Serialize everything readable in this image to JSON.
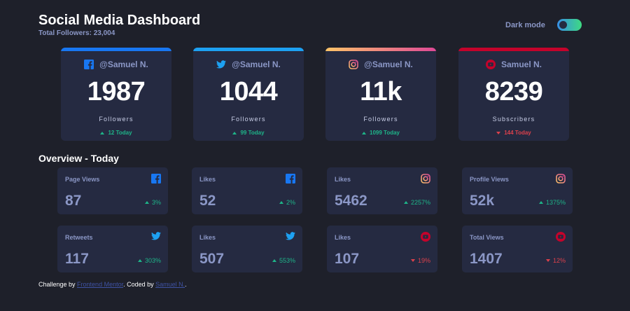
{
  "header": {
    "title": "Social Media Dashboard",
    "subtitle": "Total Followers: 23,004",
    "dark_mode_label": "Dark mode"
  },
  "cards": [
    {
      "platform": "facebook",
      "icon": "facebook-icon",
      "handle": "@Samuel N.",
      "count": "1987",
      "label": "Followers",
      "change": "12 Today",
      "trend": "up",
      "color": "#1877f2"
    },
    {
      "platform": "twitter",
      "icon": "twitter-icon",
      "handle": "@Samuel N.",
      "count": "1044",
      "label": "Followers",
      "change": "99 Today",
      "trend": "up",
      "color": "#1da1f2"
    },
    {
      "platform": "instagram",
      "icon": "instagram-icon",
      "handle": "@Samuel N.",
      "count": "11k",
      "label": "Followers",
      "change": "1099 Today",
      "trend": "up",
      "color": "#df4996"
    },
    {
      "platform": "youtube",
      "icon": "youtube-icon",
      "handle": "Samuel N.",
      "count": "8239",
      "label": "Subscribers",
      "change": "144 Today",
      "trend": "down",
      "color": "#c4032b"
    }
  ],
  "overview": {
    "title": "Overview - Today",
    "items": [
      {
        "label": "Page Views",
        "icon": "facebook-icon",
        "value": "87",
        "change": "3%",
        "trend": "up"
      },
      {
        "label": "Likes",
        "icon": "facebook-icon",
        "value": "52",
        "change": "2%",
        "trend": "up"
      },
      {
        "label": "Likes",
        "icon": "instagram-icon",
        "value": "5462",
        "change": "2257%",
        "trend": "up"
      },
      {
        "label": "Profile Views",
        "icon": "instagram-icon",
        "value": "52k",
        "change": "1375%",
        "trend": "up"
      },
      {
        "label": "Retweets",
        "icon": "twitter-icon",
        "value": "117",
        "change": "303%",
        "trend": "up"
      },
      {
        "label": "Likes",
        "icon": "twitter-icon",
        "value": "507",
        "change": "553%",
        "trend": "up"
      },
      {
        "label": "Likes",
        "icon": "youtube-icon",
        "value": "107",
        "change": "19%",
        "trend": "down"
      },
      {
        "label": "Total Views",
        "icon": "youtube-icon",
        "value": "1407",
        "change": "12%",
        "trend": "down"
      }
    ]
  },
  "footer": {
    "prefix": "Challenge by ",
    "challenge_link": "Frontend Mentor",
    "middle": ". Coded by ",
    "author_link": "Samuel N.",
    "suffix": "."
  },
  "colors": {
    "background": "#1e202a",
    "card": "#252a41",
    "muted_text": "#8b97c6",
    "up": "#1eb589",
    "down": "#dc414c",
    "link": "#3e52a3"
  }
}
